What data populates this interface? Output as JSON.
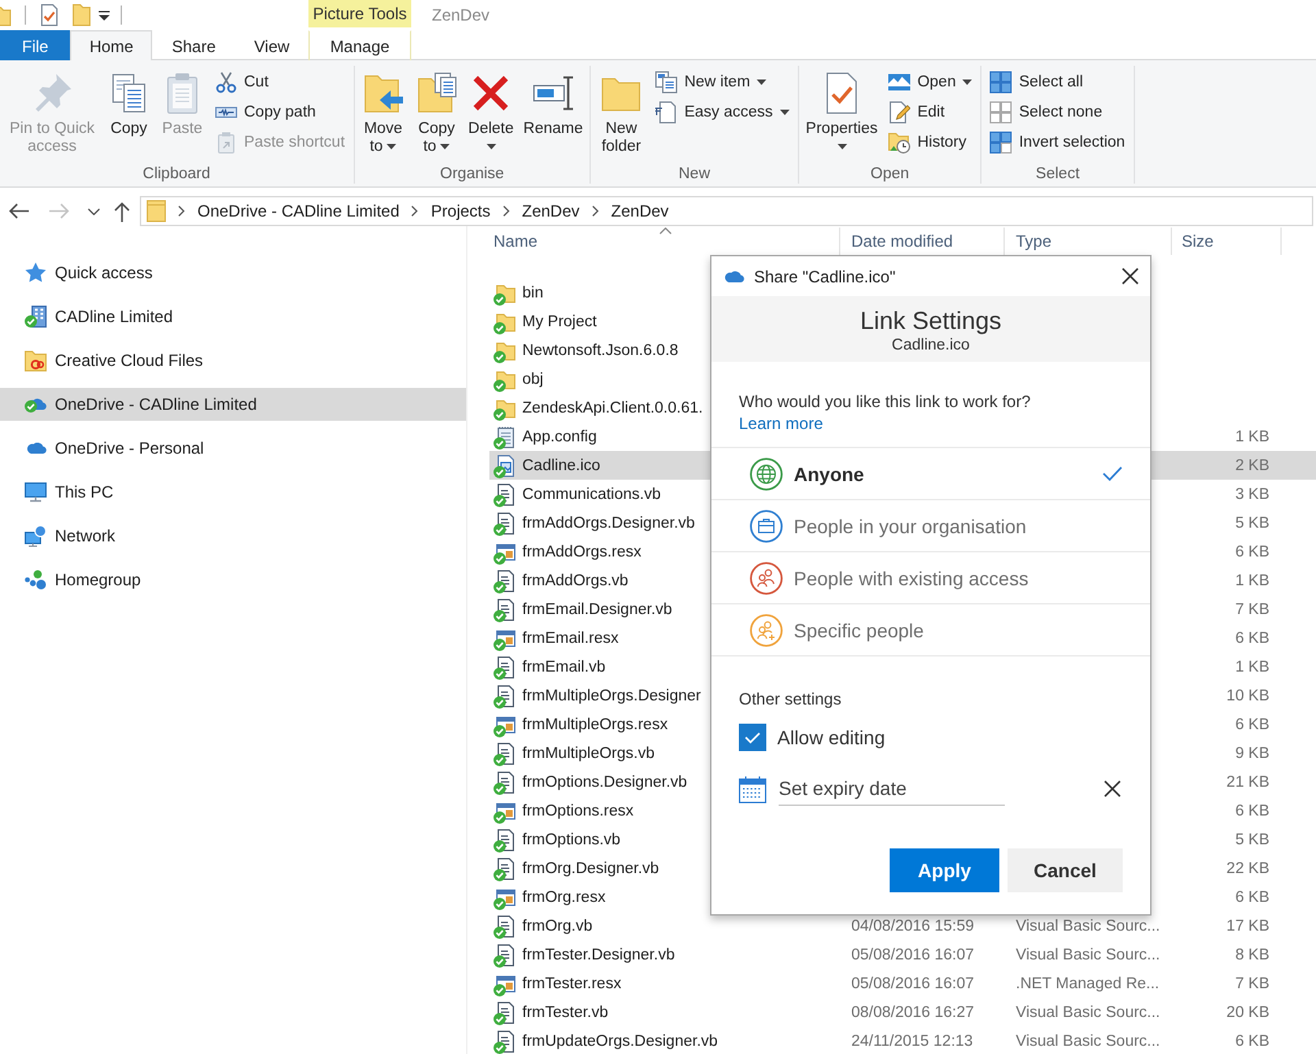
{
  "window": {
    "title": "ZenDev",
    "context_tab_group": "Picture Tools"
  },
  "ribbon_tabs": [
    {
      "label": "File",
      "kind": "file",
      "selected": false
    },
    {
      "label": "Home",
      "kind": "standard",
      "selected": true
    },
    {
      "label": "Share",
      "kind": "standard",
      "selected": false
    },
    {
      "label": "View",
      "kind": "standard",
      "selected": false
    },
    {
      "label": "Manage",
      "kind": "contextual",
      "selected": false
    }
  ],
  "ribbon_groups": [
    {
      "label": "Clipboard",
      "large": [
        {
          "label": "Pin to Quick access",
          "kind": "pin",
          "disabled": true,
          "dropdown": false
        },
        {
          "label": "Copy",
          "kind": "copy",
          "disabled": false,
          "dropdown": false
        },
        {
          "label": "Paste",
          "kind": "paste",
          "disabled": true,
          "dropdown": false
        }
      ],
      "small": [
        {
          "label": "Cut",
          "kind": "cut",
          "disabled": false,
          "dropdown": false
        },
        {
          "label": "Copy path",
          "kind": "copypath",
          "disabled": false,
          "dropdown": false
        },
        {
          "label": "Paste shortcut",
          "kind": "pasteshortcut",
          "disabled": true,
          "dropdown": false
        }
      ]
    },
    {
      "label": "Organise",
      "large": [
        {
          "label": "Move to",
          "kind": "move",
          "disabled": false,
          "dropdown": true
        },
        {
          "label": "Copy to",
          "kind": "copyto",
          "disabled": false,
          "dropdown": true
        },
        {
          "label": "Delete",
          "kind": "delete",
          "disabled": false,
          "dropdown": true
        },
        {
          "label": "Rename",
          "kind": "rename",
          "disabled": false,
          "dropdown": false
        }
      ]
    },
    {
      "label": "New",
      "large": [
        {
          "label": "New folder",
          "kind": "newfolder",
          "disabled": false,
          "dropdown": false
        }
      ],
      "small": [
        {
          "label": "New item",
          "kind": "newitem",
          "disabled": false,
          "dropdown": true
        },
        {
          "label": "Easy access",
          "kind": "easyaccess",
          "disabled": false,
          "dropdown": true
        }
      ]
    },
    {
      "label": "Open",
      "large": [
        {
          "label": "Properties",
          "kind": "properties",
          "disabled": false,
          "dropdown": true
        }
      ],
      "small": [
        {
          "label": "Open",
          "kind": "open",
          "disabled": false,
          "dropdown": true
        },
        {
          "label": "Edit",
          "kind": "edit",
          "disabled": false,
          "dropdown": false
        },
        {
          "label": "History",
          "kind": "history",
          "disabled": false,
          "dropdown": false
        }
      ]
    },
    {
      "label": "Select",
      "small": [
        {
          "label": "Select all",
          "kind": "selectall",
          "disabled": false,
          "dropdown": false
        },
        {
          "label": "Select none",
          "kind": "selectnone",
          "disabled": false,
          "dropdown": false
        },
        {
          "label": "Invert selection",
          "kind": "invert",
          "disabled": false,
          "dropdown": false
        }
      ]
    }
  ],
  "navigation": [
    {
      "kind": "back",
      "disabled": false
    },
    {
      "kind": "forward",
      "disabled": true
    },
    {
      "kind": "recent",
      "disabled": false
    },
    {
      "kind": "up",
      "disabled": false
    }
  ],
  "address_bar": {
    "crumbs": [
      "OneDrive - CADline Limited",
      "Projects",
      "ZenDev",
      "ZenDev"
    ]
  },
  "sidebar": {
    "items": [
      {
        "label": "Quick access",
        "kind": "quickaccess",
        "selected": false
      },
      {
        "label": "CADline Limited",
        "kind": "business",
        "selected": false
      },
      {
        "label": "Creative Cloud Files",
        "kind": "creativecloud",
        "selected": false
      },
      {
        "label": "OneDrive - CADline Limited",
        "kind": "onedrivebusiness",
        "selected": true
      },
      {
        "label": "OneDrive - Personal",
        "kind": "onedrive",
        "selected": false
      },
      {
        "label": "This PC",
        "kind": "pc",
        "selected": false
      },
      {
        "label": "Network",
        "kind": "network",
        "selected": false
      },
      {
        "label": "Homegroup",
        "kind": "homegroup",
        "selected": false
      }
    ]
  },
  "file_list": {
    "columns": [
      {
        "label": "Name",
        "sorted": true
      },
      {
        "label": "Date modified",
        "sorted": false
      },
      {
        "label": "Type",
        "sorted": false
      },
      {
        "label": "Size",
        "sorted": false
      }
    ],
    "rows": [
      {
        "name": "bin",
        "kind": "folder",
        "synced": true,
        "selected": false
      },
      {
        "name": "My Project",
        "kind": "folder",
        "synced": true,
        "selected": false
      },
      {
        "name": "Newtonsoft.Json.6.0.8",
        "kind": "folder",
        "synced": true,
        "selected": false
      },
      {
        "name": "obj",
        "kind": "folder",
        "synced": true,
        "selected": false
      },
      {
        "name": "ZendeskApi.Client.0.0.61.",
        "kind": "folder",
        "synced": true,
        "selected": false
      },
      {
        "name": "App.config",
        "kind": "config",
        "synced": true,
        "selected": false,
        "size": "1 KB"
      },
      {
        "name": "Cadline.ico",
        "kind": "image",
        "synced": true,
        "selected": true,
        "size": "2 KB"
      },
      {
        "name": "Communications.vb",
        "kind": "vb",
        "synced": true,
        "selected": false,
        "size": "3 KB"
      },
      {
        "name": "frmAddOrgs.Designer.vb",
        "kind": "vb",
        "synced": true,
        "selected": false,
        "size": "5 KB"
      },
      {
        "name": "frmAddOrgs.resx",
        "kind": "resx",
        "synced": true,
        "selected": false,
        "size": "6 KB"
      },
      {
        "name": "frmAddOrgs.vb",
        "kind": "vb",
        "synced": true,
        "selected": false,
        "size": "1 KB"
      },
      {
        "name": "frmEmail.Designer.vb",
        "kind": "vb",
        "synced": true,
        "selected": false,
        "size": "7 KB"
      },
      {
        "name": "frmEmail.resx",
        "kind": "resx",
        "synced": true,
        "selected": false,
        "size": "6 KB"
      },
      {
        "name": "frmEmail.vb",
        "kind": "vb",
        "synced": true,
        "selected": false,
        "size": "1 KB"
      },
      {
        "name": "frmMultipleOrgs.Designer",
        "kind": "vb",
        "synced": true,
        "selected": false,
        "size": "10 KB"
      },
      {
        "name": "frmMultipleOrgs.resx",
        "kind": "resx",
        "synced": true,
        "selected": false,
        "size": "6 KB"
      },
      {
        "name": "frmMultipleOrgs.vb",
        "kind": "vb",
        "synced": true,
        "selected": false,
        "size": "9 KB"
      },
      {
        "name": "frmOptions.Designer.vb",
        "kind": "vb",
        "synced": true,
        "selected": false,
        "size": "21 KB"
      },
      {
        "name": "frmOptions.resx",
        "kind": "resx",
        "synced": true,
        "selected": false,
        "size": "6 KB"
      },
      {
        "name": "frmOptions.vb",
        "kind": "vb",
        "synced": true,
        "selected": false,
        "size": "5 KB"
      },
      {
        "name": "frmOrg.Designer.vb",
        "kind": "vb",
        "synced": true,
        "selected": false,
        "size": "22 KB"
      },
      {
        "name": "frmOrg.resx",
        "kind": "resx",
        "synced": true,
        "selected": false,
        "size": "6 KB"
      },
      {
        "name": "frmOrg.vb",
        "kind": "vb",
        "synced": true,
        "selected": false,
        "date": "04/08/2016 15:59",
        "type": "Visual Basic Sourc...",
        "size": "17 KB"
      },
      {
        "name": "frmTester.Designer.vb",
        "kind": "vb",
        "synced": true,
        "selected": false,
        "date": "05/08/2016 16:07",
        "type": "Visual Basic Sourc...",
        "size": "8 KB"
      },
      {
        "name": "frmTester.resx",
        "kind": "resx",
        "synced": true,
        "selected": false,
        "date": "05/08/2016 16:07",
        "type": ".NET Managed Re...",
        "size": "7 KB"
      },
      {
        "name": "frmTester.vb",
        "kind": "vb",
        "synced": true,
        "selected": false,
        "date": "08/08/2016 16:27",
        "type": "Visual Basic Sourc...",
        "size": "20 KB"
      },
      {
        "name": "frmUpdateOrgs.Designer.vb",
        "kind": "vb",
        "synced": true,
        "selected": false,
        "date": "24/11/2015 12:13",
        "type": "Visual Basic Sourc...",
        "size": "6 KB"
      }
    ]
  },
  "share_dialog": {
    "title": "Share \"Cadline.ico\"",
    "heading": "Link Settings",
    "subheading": "Cadline.ico",
    "question": "Who would you like this link to work for?",
    "learn_more_link": "Learn more",
    "audience_options": [
      {
        "label": "Anyone",
        "kind": "anyone",
        "color": "#3a9a48",
        "selected": true
      },
      {
        "label": "People in your organisation",
        "kind": "organisation",
        "color": "#2f7fd1",
        "selected": false
      },
      {
        "label": "People with existing access",
        "kind": "existing",
        "color": "#d5573d",
        "selected": false
      },
      {
        "label": "Specific people",
        "kind": "specific",
        "color": "#f0a33c",
        "selected": false
      }
    ],
    "other_settings_label": "Other settings",
    "allow_editing": {
      "label": "Allow editing",
      "checked": true
    },
    "expiry_field": {
      "placeholder": "Set expiry date"
    },
    "buttons": [
      {
        "label": "Apply",
        "kind": "primary"
      },
      {
        "label": "Cancel",
        "kind": "secondary"
      }
    ]
  }
}
